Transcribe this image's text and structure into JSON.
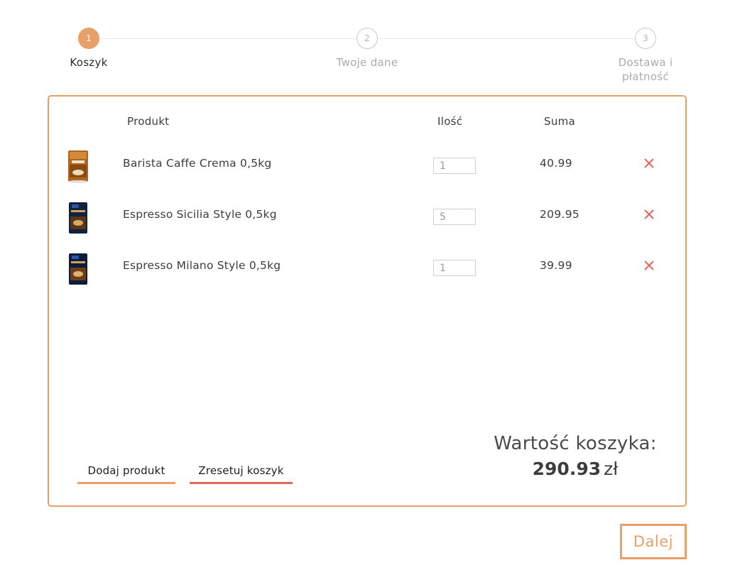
{
  "stepper": {
    "steps": [
      {
        "number": "1",
        "label": "Koszyk",
        "state": "active"
      },
      {
        "number": "2",
        "label": "Twoje dane",
        "state": "idle"
      },
      {
        "number": "3",
        "label_line1": "Dostawa i",
        "label_line2": "płatność",
        "state": "idle"
      }
    ]
  },
  "cart": {
    "headers": {
      "product": "Produkt",
      "quantity": "Ilość",
      "sum": "Suma"
    },
    "items": [
      {
        "name": "Barista Caffe Crema 0,5kg",
        "quantity": "1",
        "sum": "40.99",
        "image": "coffee-bag-barista"
      },
      {
        "name": "Espresso Sicilia Style 0,5kg",
        "quantity": "5",
        "sum": "209.95",
        "image": "coffee-bag-sicilia"
      },
      {
        "name": "Espresso Milano Style 0,5kg",
        "quantity": "1",
        "sum": "39.99",
        "image": "coffee-bag-milano"
      }
    ],
    "remove_icon": "close-x-icon",
    "actions": {
      "add_product": "Dodaj produkt",
      "reset_cart": "Zresetuj koszyk"
    },
    "total": {
      "label": "Wartość koszyka:",
      "amount": "290.93",
      "currency": "zł"
    }
  },
  "next_button": "Dalej",
  "colors": {
    "accent": "#e9a068",
    "danger": "#e2675e",
    "text": "#3d3d3d",
    "muted": "#ababab"
  }
}
